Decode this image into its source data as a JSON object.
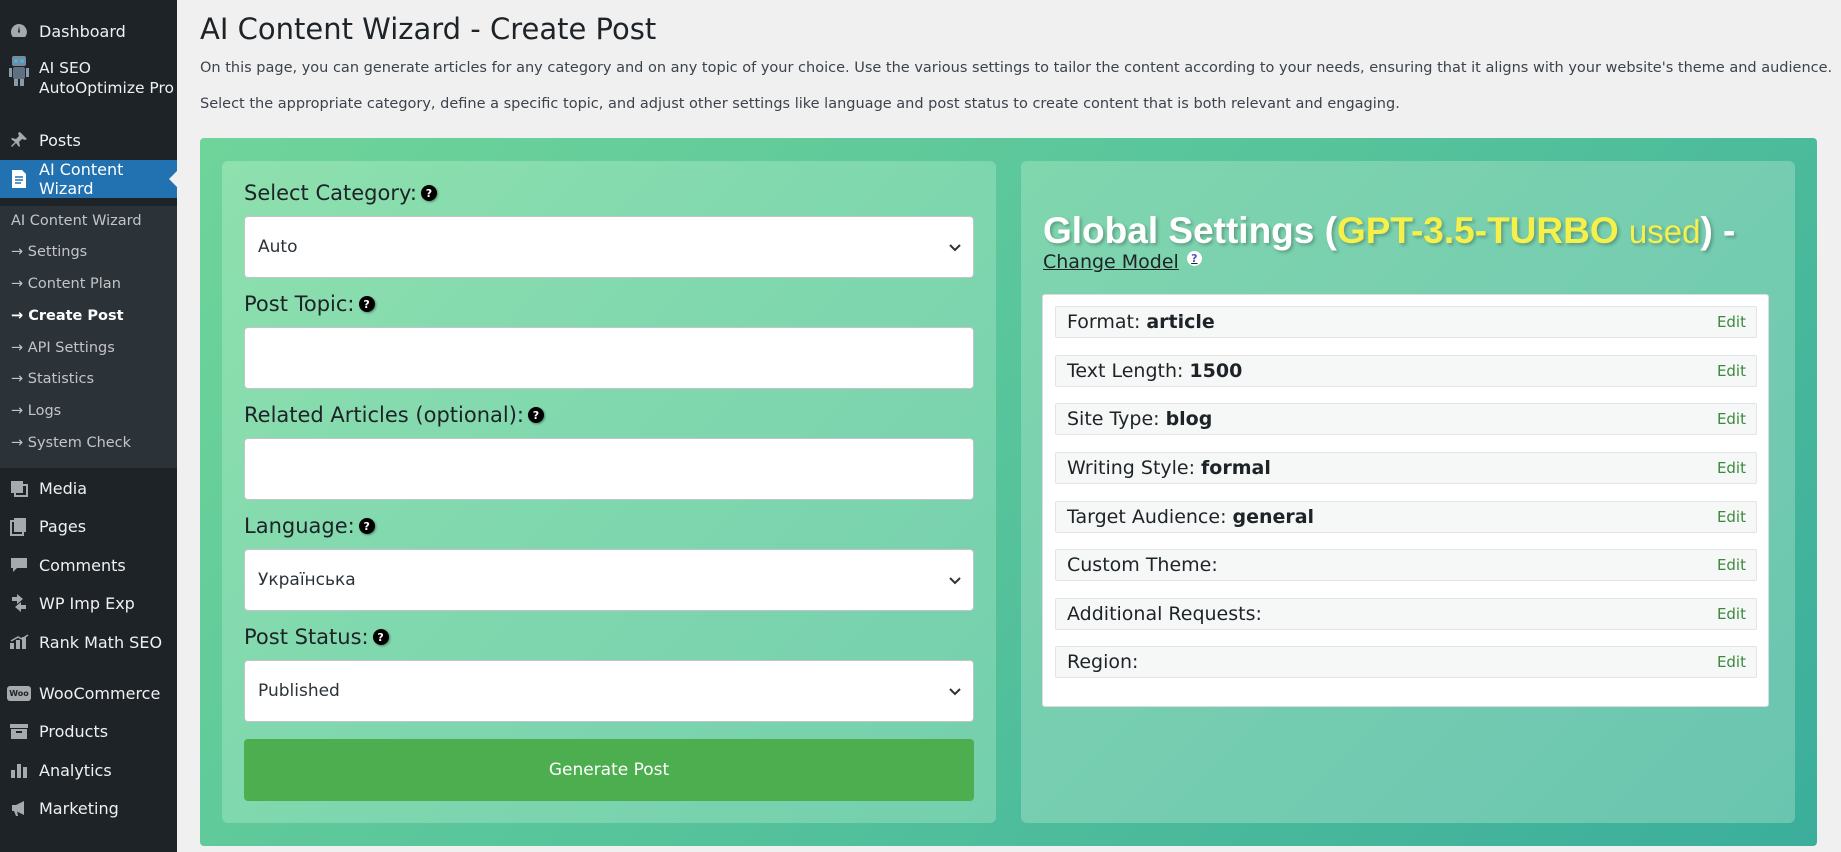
{
  "sidebar": {
    "top_items": [
      {
        "label": "Dashboard",
        "icon": "dashboard-icon"
      },
      {
        "label": "AI SEO AutoOptimize Pro",
        "label_line1": "AI SEO",
        "label_line2": "AutoOptimize Pro",
        "icon": "robot-icon"
      },
      {
        "label": "Posts",
        "icon": "pin-icon"
      },
      {
        "label": "AI Content Wizard",
        "icon": "document-icon"
      }
    ],
    "submenu": [
      {
        "label": "AI Content Wizard"
      },
      {
        "label": "→ Settings"
      },
      {
        "label": "→ Content Plan"
      },
      {
        "label": "→ Create Post",
        "active": true
      },
      {
        "label": "→ API Settings"
      },
      {
        "label": "→ Statistics"
      },
      {
        "label": "→ Logs"
      },
      {
        "label": "→ System Check"
      }
    ],
    "bottom_items": [
      {
        "label": "Media",
        "icon": "media-icon"
      },
      {
        "label": "Pages",
        "icon": "pages-icon"
      },
      {
        "label": "Comments",
        "icon": "comments-icon"
      },
      {
        "label": "WP Imp Exp",
        "icon": "import-export-icon"
      },
      {
        "label": "Rank Math SEO",
        "icon": "rank-math-icon"
      },
      {
        "label": "WooCommerce",
        "icon": "woo-icon",
        "icon_text": "Woo"
      },
      {
        "label": "Products",
        "icon": "products-icon"
      },
      {
        "label": "Analytics",
        "icon": "analytics-icon"
      },
      {
        "label": "Marketing",
        "icon": "megaphone-icon"
      }
    ]
  },
  "page": {
    "title": "AI Content Wizard - Create Post",
    "intro1": "On this page, you can generate articles for any category and on any topic of your choice. Use the various settings to tailor the content according to your needs, ensuring that it aligns with your website's theme and audience.",
    "intro2": "Select the appropriate category, define a specific topic, and adjust other settings like language and post status to create content that is both relevant and engaging."
  },
  "form": {
    "category": {
      "label": "Select Category:",
      "value": "Auto"
    },
    "topic": {
      "label": "Post Topic:",
      "value": ""
    },
    "related": {
      "label": "Related Articles (optional):",
      "value": ""
    },
    "language": {
      "label": "Language:",
      "value": "Українська"
    },
    "status": {
      "label": "Post Status:",
      "value": "Published"
    },
    "help_glyph": "?",
    "generate_label": "Generate Post"
  },
  "global": {
    "heading_prefix": "Global Settings (",
    "model": "GPT-3.5-TURBO",
    "used": "used",
    "heading_suffix": ") -",
    "change_model": "Change Model",
    "help_glyph": "?",
    "edit_label": "Edit",
    "settings": [
      {
        "label": "Format:",
        "value": "article"
      },
      {
        "label": "Text Length:",
        "value": "1500"
      },
      {
        "label": "Site Type:",
        "value": "blog"
      },
      {
        "label": "Writing Style:",
        "value": "formal"
      },
      {
        "label": "Target Audience:",
        "value": "general"
      },
      {
        "label": "Custom Theme:",
        "value": ""
      },
      {
        "label": "Additional Requests:",
        "value": ""
      },
      {
        "label": "Region:",
        "value": ""
      }
    ]
  },
  "colors": {
    "sidebar_bg": "#1d2327",
    "accent_blue": "#2271b1",
    "generate_green": "#4cae4f",
    "model_yellow": "#f6f04a"
  }
}
